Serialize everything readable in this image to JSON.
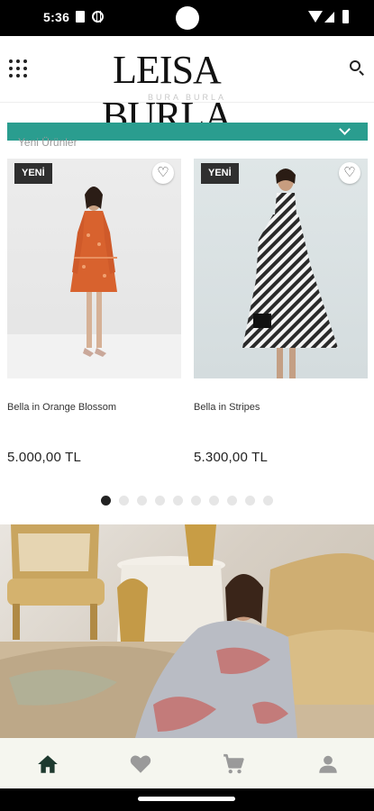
{
  "status_bar": {
    "time": "5:36"
  },
  "header": {
    "brand": "LEISA BURLA"
  },
  "section": {
    "faded_heading": "BURA BURLA",
    "filter_label": "Yeni Ürünler"
  },
  "products": [
    {
      "badge": "YENİ",
      "name": "Bella in Orange Blossom",
      "price": "5.000,00 TL"
    },
    {
      "badge": "YENİ",
      "name": "Bella in Stripes",
      "price": "5.300,00 TL"
    }
  ],
  "pager": {
    "count": 10,
    "active_index": 0
  },
  "icons": {
    "menu": "grid-menu-icon",
    "search": "search-icon",
    "favorite": "heart-outline-icon",
    "filter": "chevron-down-icon",
    "nav": [
      "home-icon",
      "heart-icon",
      "cart-icon",
      "user-icon"
    ]
  },
  "colors": {
    "accent": "#2a9d8f",
    "badge_bg": "#2f2f2f",
    "nav_active": "#1e3a2f",
    "nav_inactive": "#9a9a9a",
    "nav_bg": "#f5f6ef"
  }
}
